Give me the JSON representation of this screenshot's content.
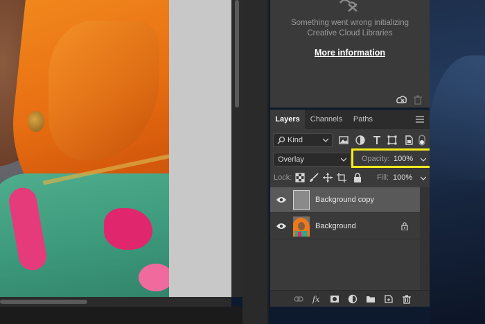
{
  "libraries": {
    "message_line1": "Something went wrong initializing",
    "message_line2": "Creative Cloud Libraries",
    "link": "More information"
  },
  "layers_panel": {
    "tabs": [
      {
        "label": "Layers",
        "active": true
      },
      {
        "label": "Channels",
        "active": false
      },
      {
        "label": "Paths",
        "active": false
      }
    ],
    "filter": {
      "selected": "Kind"
    },
    "blend_mode": "Overlay",
    "opacity": {
      "label": "Opacity:",
      "value": "100%"
    },
    "lock_label": "Lock:",
    "fill": {
      "label": "Fill:",
      "value": "100%"
    },
    "layers": [
      {
        "name": "Background copy",
        "visible": true,
        "selected": true,
        "locked": false
      },
      {
        "name": "Background",
        "visible": true,
        "selected": false,
        "locked": true
      }
    ]
  },
  "colors": {
    "panel_bg": "#3a3a3a",
    "tab_bar_bg": "#2c2c2c",
    "selected_layer_bg": "#595959",
    "highlight_box": "#f4ec1c"
  },
  "icons": {
    "filter": [
      "image-filter-icon",
      "adjustment-filter-icon",
      "type-filter-icon",
      "shape-filter-icon",
      "smart-object-filter-icon",
      "filter-toggle-icon"
    ],
    "lock": [
      "lock-transparent-pixels-icon",
      "lock-image-pixels-icon",
      "lock-position-icon",
      "lock-artboard-icon",
      "lock-all-icon"
    ],
    "footer": [
      "link-layers-icon",
      "fx-icon",
      "add-mask-icon",
      "adjustment-layer-icon",
      "new-group-icon",
      "new-layer-icon",
      "delete-layer-icon"
    ]
  }
}
